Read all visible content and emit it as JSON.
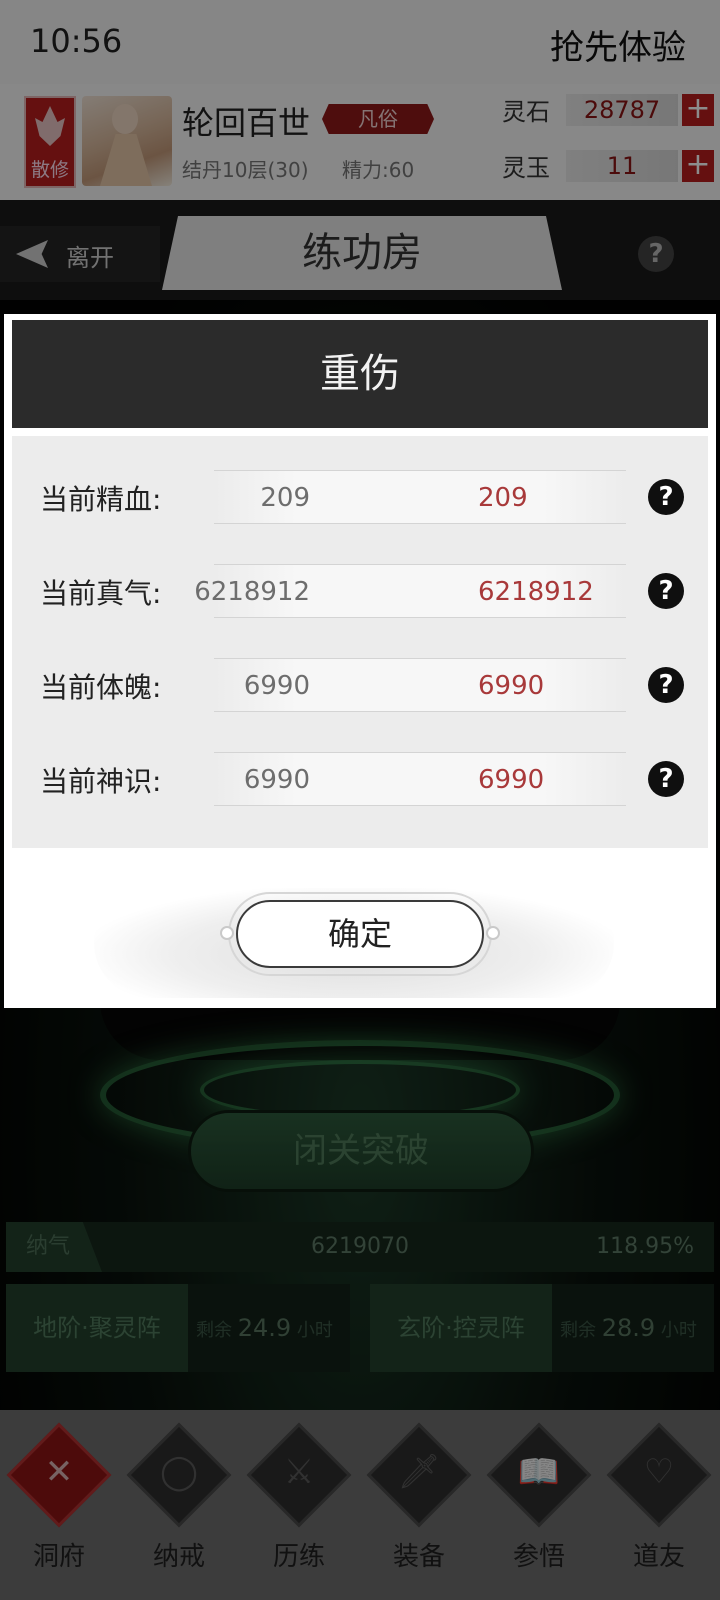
{
  "status_bar": {
    "time": "10:56",
    "promo": "抢先体验"
  },
  "player": {
    "rank_badge": "散修",
    "name": "轮回百世",
    "realm": "凡俗",
    "cultivation": "结丹10层(30)",
    "energy": "精力:60"
  },
  "currencies": [
    {
      "label": "灵石",
      "value": "28787",
      "add": "+"
    },
    {
      "label": "灵玉",
      "value": "11",
      "add": "+"
    }
  ],
  "nav": {
    "back_label": "离开",
    "room_title": "练功房",
    "help": "?"
  },
  "main": {
    "breakthrough": "闭关突破",
    "absorb": {
      "label": "纳气",
      "value": "6219070",
      "percent": "118.95%"
    },
    "arrays": [
      {
        "name": "地阶·聚灵阵",
        "remain_prefix": "剩余",
        "remain_value": "24.9",
        "remain_unit": "小时"
      },
      {
        "name": "玄阶·控灵阵",
        "remain_prefix": "剩余",
        "remain_value": "28.9",
        "remain_unit": "小时"
      }
    ]
  },
  "bottom_nav": [
    {
      "label": "洞府",
      "icon": "close-x-icon",
      "glyph": "✕",
      "active": true
    },
    {
      "label": "纳戒",
      "icon": "ring-icon",
      "glyph": "◯",
      "active": false
    },
    {
      "label": "历练",
      "icon": "crossed-swords-icon",
      "glyph": "⚔",
      "active": false
    },
    {
      "label": "装备",
      "icon": "dagger-icon",
      "glyph": "🗡",
      "active": false
    },
    {
      "label": "参悟",
      "icon": "open-book-icon",
      "glyph": "📖",
      "active": false
    },
    {
      "label": "道友",
      "icon": "handshake-icon",
      "glyph": "♡",
      "active": false
    }
  ],
  "dialog": {
    "title": "重伤",
    "stats": [
      {
        "label": "当前精血:",
        "current": "209",
        "max": "209"
      },
      {
        "label": "当前真气:",
        "current": "6218912",
        "max": "6218912"
      },
      {
        "label": "当前体魄:",
        "current": "6990",
        "max": "6990"
      },
      {
        "label": "当前神识:",
        "current": "6990",
        "max": "6990"
      }
    ],
    "help_glyph": "?",
    "confirm": "确定"
  },
  "colors": {
    "accent_red": "#b81e1e",
    "value_red": "#a8393a",
    "dialog_header": "#2b2b2b",
    "glow_green": "#46b464"
  }
}
